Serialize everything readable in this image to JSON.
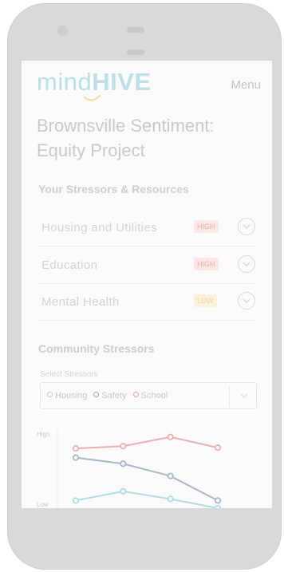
{
  "header": {
    "logo_light": "mind",
    "logo_bold": "HIVE",
    "menu_label": "Menu"
  },
  "page_title": "Brownsville Sentiment: Equity Project",
  "stressors_section": {
    "heading": "Your Stressors & Resources",
    "items": [
      {
        "label": "Housing and Utilities",
        "level": "HIGH"
      },
      {
        "label": "Education",
        "level": "HIGH"
      },
      {
        "label": "Mental Health",
        "level": "LOW"
      }
    ]
  },
  "community_section": {
    "heading": "Community Stressors",
    "select_label": "Select Stressors",
    "selected_tags": [
      {
        "label": "Housing",
        "color": "#9fd8e2"
      },
      {
        "label": "Safety",
        "color": "#98a9c2"
      },
      {
        "label": "School",
        "color": "#eb9c9c"
      }
    ]
  },
  "colors": {
    "high_badge_bg": "#fbe7e6",
    "low_badge_bg": "#fbf1dc"
  },
  "chart_data": {
    "type": "line",
    "ylabel_top": "High",
    "ylabel_bottom": "Low",
    "x": [
      1,
      2,
      3,
      4
    ],
    "ylim": [
      0,
      10
    ],
    "series": [
      {
        "name": "School",
        "color": "#ebb0b0",
        "values": [
          7.8,
          8.1,
          9.3,
          7.9
        ]
      },
      {
        "name": "Safety",
        "color": "#a9b6c9",
        "values": [
          6.6,
          5.8,
          4.2,
          1.0
        ]
      },
      {
        "name": "Housing",
        "color": "#b0dde5",
        "values": [
          1.0,
          2.2,
          1.2,
          0.0
        ]
      }
    ]
  }
}
